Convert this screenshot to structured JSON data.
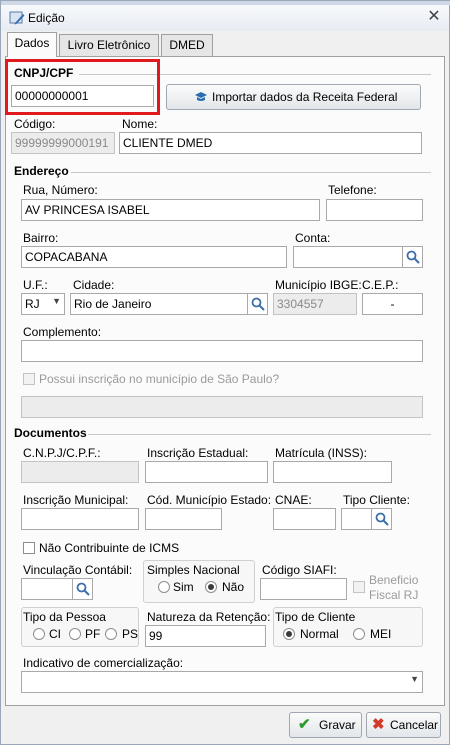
{
  "window": {
    "title": "Edição"
  },
  "tabs": [
    {
      "label": "Dados"
    },
    {
      "label": "Livro Eletrônico"
    },
    {
      "label": "DMED"
    }
  ],
  "cnpj": {
    "section_label": "CNPJ/CPF",
    "value": "00000000001",
    "import_button": "Importar dados da Receita Federal"
  },
  "codigo": {
    "label": "Código:",
    "value": "99999999000191"
  },
  "nome": {
    "label": "Nome:",
    "value": "CLIENTE DMED"
  },
  "endereco": {
    "section_label": "Endereço",
    "rua_label": "Rua, Número:",
    "rua_value": "AV PRINCESA ISABEL",
    "telefone_label": "Telefone:",
    "telefone_value": "",
    "bairro_label": "Bairro:",
    "bairro_value": "COPACABANA",
    "conta_label": "Conta:",
    "conta_value": "",
    "uf_label": "U.F.:",
    "uf_value": "RJ",
    "cidade_label": "Cidade:",
    "cidade_value": "Rio de Janeiro",
    "ibge_label": "Município IBGE:",
    "ibge_value": "3304557",
    "cep_label": "C.E.P.:",
    "cep_value": "-",
    "complemento_label": "Complemento:",
    "complemento_value": "",
    "sp_checkbox_label": "Possui inscrição no município de São Paulo?"
  },
  "documentos": {
    "section_label": "Documentos",
    "cnpj_label": "C.N.P.J/C.P.F.:",
    "ie_label": "Inscrição Estadual:",
    "inss_label": "Matrícula (INSS):",
    "im_label": "Inscrição Municipal:",
    "cod_mun_label": "Cód. Município Estado:",
    "cnae_label": "CNAE:",
    "tipo_cliente_label": "Tipo Cliente:",
    "nao_contrib_label": "Não Contribuinte de ICMS",
    "vinc_label": "Vinculação Contábil:",
    "simples_label": "Simples Nacional",
    "simples_sim": "Sim",
    "simples_nao": "Não",
    "siafi_label": "Código SIAFI:",
    "beneficio_label_1": "Beneficio",
    "beneficio_label_2": "Fiscal RJ",
    "tipo_pessoa_label": "Tipo da Pessoa",
    "tp_ci": "CI",
    "tp_pf": "PF",
    "tp_ps": "PS",
    "natureza_label": "Natureza da Retenção:",
    "natureza_value": "99",
    "tipo_de_cliente_label": "Tipo de Cliente",
    "tc_normal": "Normal",
    "tc_mei": "MEI",
    "indicativo_label": "Indicativo de comercialização:",
    "indicativo_value": ""
  },
  "footer": {
    "gravar": "Gravar",
    "cancelar": "Cancelar"
  },
  "colors": {
    "highlight": "#e0191f",
    "accent_green": "#2e9b2e",
    "accent_red": "#d23a2a"
  }
}
